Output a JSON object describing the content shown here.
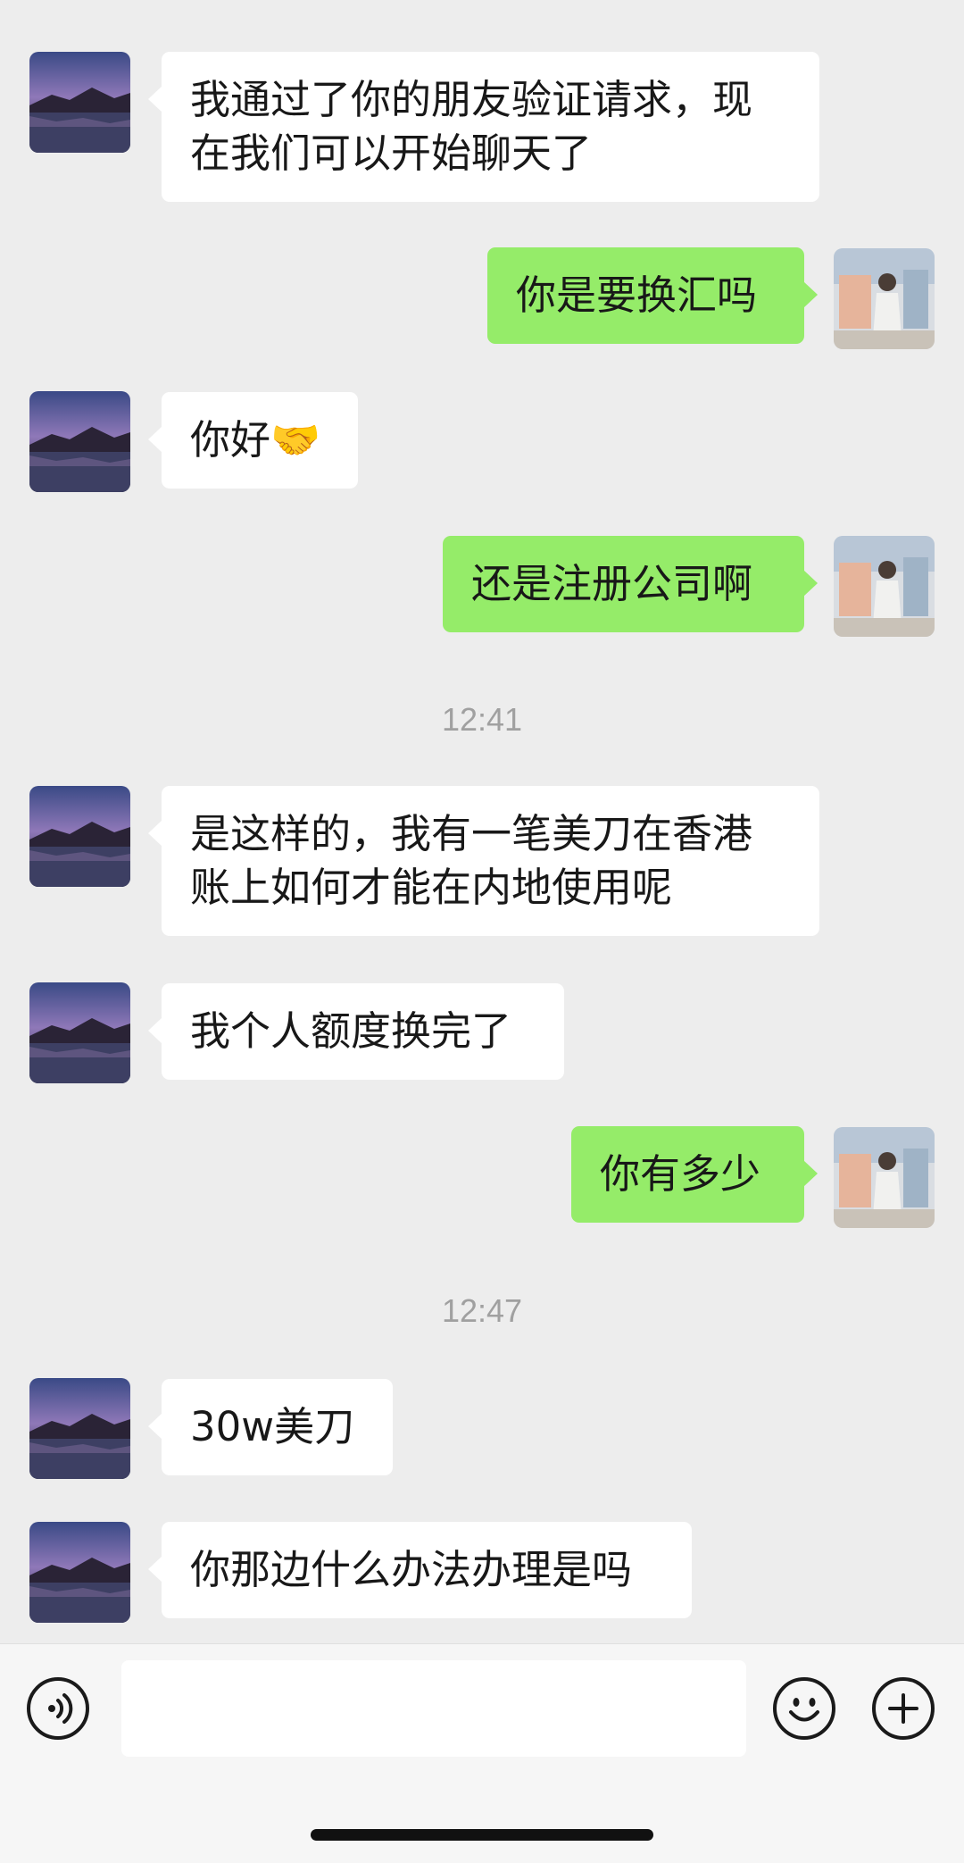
{
  "messages": [
    {
      "side": "in",
      "lines": [
        "我通过了你的朋友验证请求，现",
        "在我们可以开始聊天了"
      ]
    },
    {
      "side": "out",
      "text": "你是要换汇吗"
    },
    {
      "side": "in",
      "text": "你好",
      "emoji": "🤝"
    },
    {
      "side": "out",
      "text": "还是注册公司啊"
    },
    {
      "timestamp": "12:41"
    },
    {
      "side": "in",
      "lines": [
        "是这样的，我有一笔美刀在香港",
        "账上如何才能在内地使用呢"
      ]
    },
    {
      "side": "in",
      "text": "我个人额度换完了"
    },
    {
      "side": "out",
      "text": "你有多少"
    },
    {
      "timestamp": "12:47"
    },
    {
      "side": "in",
      "text": "30w美刀"
    },
    {
      "side": "in",
      "text": "你那边什么办法办理是吗"
    }
  ],
  "input_bar": {
    "voice_icon": "voice-icon",
    "emoji_icon": "emoji-icon",
    "plus_icon": "plus-icon",
    "text_value": ""
  }
}
